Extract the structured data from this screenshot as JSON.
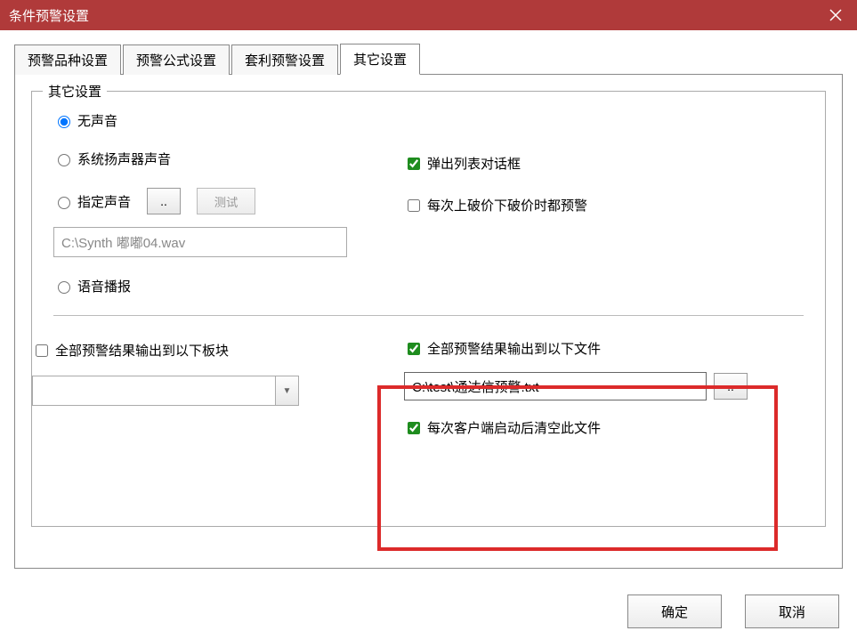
{
  "window": {
    "title": "条件预警设置"
  },
  "tabs": {
    "items": [
      {
        "label": "预警品种设置"
      },
      {
        "label": "预警公式设置"
      },
      {
        "label": "套利预警设置"
      },
      {
        "label": "其它设置"
      }
    ],
    "active_index": 3
  },
  "group": {
    "title": "其它设置"
  },
  "sound": {
    "options": {
      "none": "无声音",
      "system": "系统扬声器声音",
      "specify": "指定声音",
      "tts": "语音播报"
    },
    "browse_btn": "..",
    "test_btn": "测试",
    "path": "C:\\Synth 嘟嘟04.wav"
  },
  "right_checks": {
    "popup": "弹出列表对话框",
    "every_break": "每次上破价下破价时都预警"
  },
  "output_block": {
    "to_block_label": "全部预警结果输出到以下板块",
    "combo_value": "",
    "to_file_label": "全部预警结果输出到以下文件",
    "file_path": "C:\\test\\通达信预警.txt",
    "browse_btn": "..",
    "clear_on_start": "每次客户端启动后清空此文件"
  },
  "footer": {
    "ok": "确定",
    "cancel": "取消"
  }
}
